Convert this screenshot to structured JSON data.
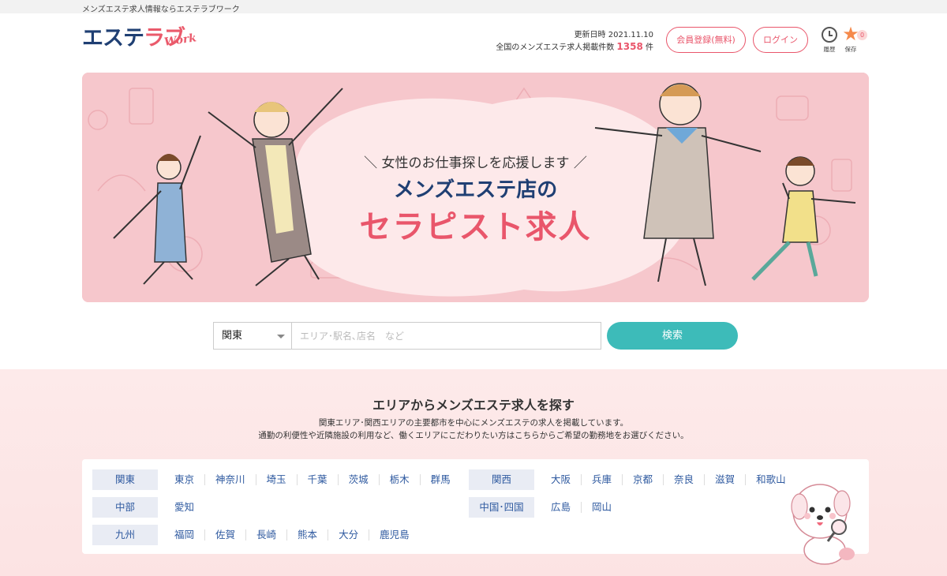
{
  "topbar": {
    "tagline": "メンズエステ求人情報ならエステラブワーク"
  },
  "header": {
    "logo_ja_1": "エステ",
    "logo_ja_2": "ラブ",
    "logo_en": "Work",
    "updated": "更新日時 2021.11.10",
    "count_prefix": "全国のメンズエステ求人掲載件数",
    "count": "1358",
    "count_suffix": "件",
    "register": "会員登録(無料)",
    "login": "ログイン",
    "history": "履歴",
    "saved": "保存",
    "saved_count": "0"
  },
  "hero": {
    "sub": "＼ 女性のお仕事探しを応援します ／",
    "title1": "メンズエステ店の",
    "title2": "セラピスト求人"
  },
  "search": {
    "region": "関東",
    "placeholder": "エリア･駅名､店名　など",
    "button": "検索"
  },
  "area": {
    "title": "エリアからメンズエステ求人を探す",
    "desc1": "関東エリア･関西エリアの主要都市を中心にメンズエステの求人を掲載しています。",
    "desc2": "通勤の利便性や近隣施設の利用など、働くエリアにこだわりたい方はこちらからご希望の勤務地をお選びください。",
    "regions": [
      {
        "name": "関東",
        "prefs": [
          "東京",
          "神奈川",
          "埼玉",
          "千葉",
          "茨城",
          "栃木",
          "群馬"
        ]
      },
      {
        "name": "関西",
        "prefs": [
          "大阪",
          "兵庫",
          "京都",
          "奈良",
          "滋賀",
          "和歌山"
        ]
      },
      {
        "name": "中部",
        "prefs": [
          "愛知"
        ]
      },
      {
        "name": "中国･四国",
        "prefs": [
          "広島",
          "岡山"
        ]
      },
      {
        "name": "九州",
        "prefs": [
          "福岡",
          "佐賀",
          "長崎",
          "熊本",
          "大分",
          "鹿児島"
        ]
      }
    ]
  },
  "colors": {
    "brand_pink": "#e9566b",
    "brand_navy": "#1f3f73",
    "accent_teal": "#3dbbb9"
  }
}
